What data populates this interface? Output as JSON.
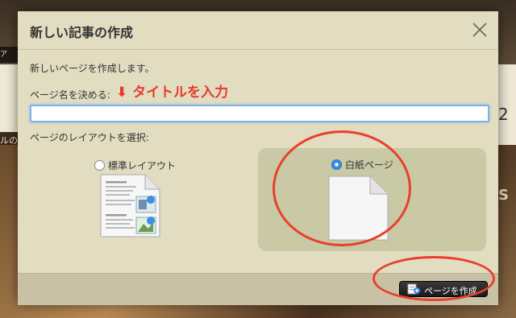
{
  "modal": {
    "title": "新しい記事の作成",
    "intro": "新しいページを作成します。",
    "name_label": "ページ名を決める:",
    "instruction": "⬇ タイトルを入力",
    "name_value": "",
    "layout_label": "ページのレイアウトを選択:",
    "options": [
      {
        "label": "標準レイアウト",
        "selected": false
      },
      {
        "label": "白紙ページ",
        "selected": true
      }
    ],
    "create_button": "ページを作成"
  },
  "background": {
    "left_text": "ルの",
    "right_number": "2",
    "right_letter": "S",
    "top_label": "ア"
  },
  "colors": {
    "modal_bg": "#e2dcc0",
    "highlight_panel": "#c9c9a6",
    "annotation_red": "#e83a2c",
    "input_focus": "#7fb0e6"
  },
  "icons": [
    "close-icon",
    "standard-layout-page-icon",
    "blank-page-icon",
    "add-page-icon"
  ]
}
